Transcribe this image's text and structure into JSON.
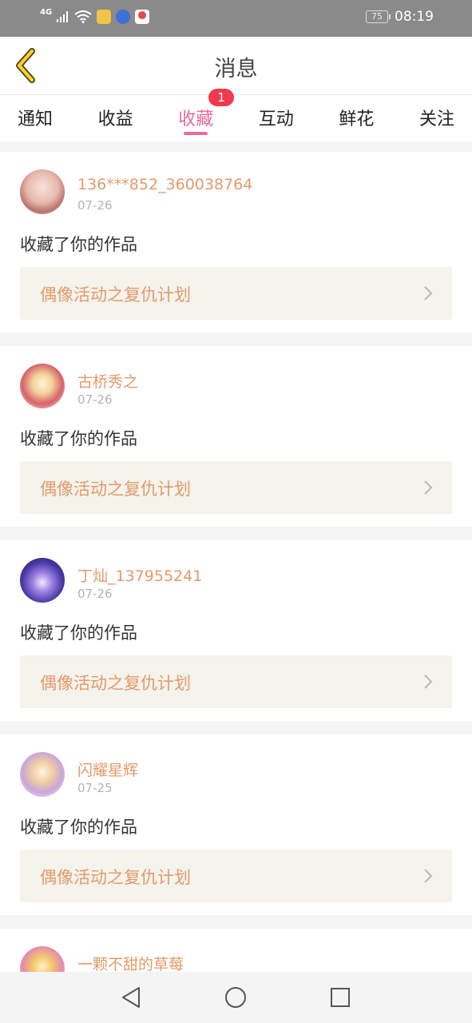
{
  "status_bar": {
    "network": "4G",
    "battery": "75",
    "time": "08:19",
    "apps": [
      "weibo-icon",
      "app-blue-icon",
      "map-pin-icon"
    ]
  },
  "header": {
    "title": "消息",
    "back_icon": "chevron-left-icon"
  },
  "tabs": [
    {
      "label": "通知",
      "active": false
    },
    {
      "label": "收益",
      "active": false
    },
    {
      "label": "收藏",
      "active": true,
      "badge": "1"
    },
    {
      "label": "互动",
      "active": false
    },
    {
      "label": "鲜花",
      "active": false
    },
    {
      "label": "关注",
      "active": false
    }
  ],
  "colors": {
    "accent": "#e86aa0",
    "username": "#e39a6a",
    "badge": "#f23a4f",
    "work_bg": "#f4f3ec"
  },
  "notifications": [
    {
      "username": "136***852_360038764",
      "date": "07-26",
      "action": "收藏了你的作品",
      "work": "偶像活动之复仇计划"
    },
    {
      "username": "古桥秀之",
      "date": "07-26",
      "action": "收藏了你的作品",
      "work": "偶像活动之复仇计划"
    },
    {
      "username": "丁灿_137955241",
      "date": "07-26",
      "action": "收藏了你的作品",
      "work": "偶像活动之复仇计划"
    },
    {
      "username": "闪耀星辉",
      "date": "07-25",
      "action": "收藏了你的作品",
      "work": "偶像活动之复仇计划"
    },
    {
      "username": "一颗不甜的草莓"
    }
  ],
  "navbar": [
    "back-triangle-icon",
    "home-circle-icon",
    "recents-square-icon"
  ]
}
